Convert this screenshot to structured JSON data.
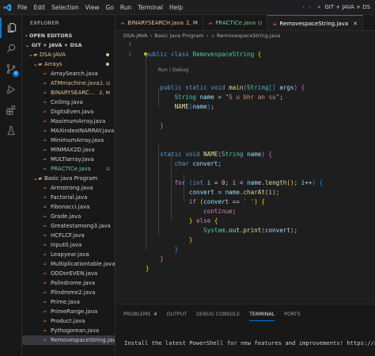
{
  "menu": [
    "File",
    "Edit",
    "Selection",
    "View",
    "Go",
    "Run",
    "Terminal",
    "Help"
  ],
  "window_title": "GIT + JAVA + DS",
  "activity": {
    "source_control_badge": "4"
  },
  "sidebar": {
    "title": "EXPLORER",
    "open_editors": "OPEN EDITORS",
    "workspace": "GIT + JAVA + DSA",
    "tree": [
      {
        "label": "DSA-JAVA",
        "type": "folder",
        "indent": 1,
        "dot": "#e2c08d"
      },
      {
        "label": "Arrays",
        "type": "folder",
        "indent": 2,
        "dot": "#e2c08d"
      },
      {
        "label": "ArraySearch.java",
        "type": "file",
        "indent": 3
      },
      {
        "label": "ATMmachine.java",
        "type": "file",
        "indent": 3,
        "status": "2, U",
        "cls": "mod"
      },
      {
        "label": "BINARYSEARC...",
        "type": "file",
        "indent": 3,
        "status": "2, M",
        "cls": "mod"
      },
      {
        "label": "Ceiling.java",
        "type": "file",
        "indent": 3
      },
      {
        "label": "DigitsEven.java",
        "type": "file",
        "indent": 3
      },
      {
        "label": "MaximumArray.java",
        "type": "file",
        "indent": 3
      },
      {
        "label": "MAXindexINARRAY.java",
        "type": "file",
        "indent": 3
      },
      {
        "label": "MinimumArray.java",
        "type": "file",
        "indent": 3
      },
      {
        "label": "MINMAX2D.java",
        "type": "file",
        "indent": 3
      },
      {
        "label": "MULTIarray.java",
        "type": "file",
        "indent": 3
      },
      {
        "label": "PRACTICe.java",
        "type": "file",
        "indent": 3,
        "status": "U",
        "cls": "untr"
      },
      {
        "label": "Basic java Program",
        "type": "folder",
        "indent": 2
      },
      {
        "label": "Armstrong.java",
        "type": "file",
        "indent": 3
      },
      {
        "label": "Factorial.java",
        "type": "file",
        "indent": 3
      },
      {
        "label": "Fibonacci.java",
        "type": "file",
        "indent": 3
      },
      {
        "label": "Grade.java",
        "type": "file",
        "indent": 3
      },
      {
        "label": "Greatestamong3.java",
        "type": "file",
        "indent": 3
      },
      {
        "label": "HCFLCF.java",
        "type": "file",
        "indent": 3
      },
      {
        "label": "Input0.java",
        "type": "file",
        "indent": 3
      },
      {
        "label": "Leapyear.java",
        "type": "file",
        "indent": 3
      },
      {
        "label": "Multiplicationtable.java",
        "type": "file",
        "indent": 3
      },
      {
        "label": "ODDorEVEN.java",
        "type": "file",
        "indent": 3
      },
      {
        "label": "Palindrome.java",
        "type": "file",
        "indent": 3
      },
      {
        "label": "Plindrome2.java",
        "type": "file",
        "indent": 3
      },
      {
        "label": "Prime.java",
        "type": "file",
        "indent": 3
      },
      {
        "label": "PrimeRange.java",
        "type": "file",
        "indent": 3
      },
      {
        "label": "Product.java",
        "type": "file",
        "indent": 3
      },
      {
        "label": "Pythogorean.java",
        "type": "file",
        "indent": 3
      },
      {
        "label": "RemovespaceString.java",
        "type": "file",
        "indent": 3,
        "selected": true
      }
    ]
  },
  "tabs": [
    {
      "label": "BINARYSEARCH.java",
      "status": "2, M",
      "cls": "mod",
      "active": false
    },
    {
      "label": "PRACTICe.java",
      "status": "U",
      "cls": "untr",
      "active": false
    },
    {
      "label": "RemovespaceString.java",
      "status": "",
      "cls": "",
      "active": true
    }
  ],
  "breadcrumb": [
    "DSA-JAVA",
    "Basic java Program",
    "RemovespaceString.java"
  ],
  "editor": {
    "line_numbers": [
      "1",
      "2"
    ],
    "codelens": "Run | Debug",
    "lines": [
      [
        [
          "kw",
          "public "
        ],
        [
          "kw",
          "class "
        ],
        [
          "ty",
          "RemovespaceString "
        ],
        [
          "br1",
          "{"
        ]
      ],
      [],
      [],
      [
        [
          "txt",
          "    "
        ],
        [
          "kw",
          "public static void "
        ],
        [
          "fn",
          "main"
        ],
        [
          "br2",
          "("
        ],
        [
          "ty",
          "String"
        ],
        [
          "br3",
          "[]"
        ],
        [
          "var",
          " args"
        ],
        [
          "br2",
          ")"
        ],
        [
          "br2",
          " {"
        ]
      ],
      [
        [
          "txt",
          "        "
        ],
        [
          "ty",
          "String "
        ],
        [
          "var",
          "name"
        ],
        [
          "txt",
          " = "
        ],
        [
          "str",
          "\"S u bhr an su\""
        ],
        [
          "txt",
          ";"
        ]
      ],
      [
        [
          "txt",
          "        "
        ],
        [
          "fn",
          "NAME"
        ],
        [
          "br3",
          "("
        ],
        [
          "var",
          "name"
        ],
        [
          "br3",
          ")"
        ],
        [
          "txt",
          ";"
        ]
      ],
      [],
      [
        [
          "txt",
          "    "
        ],
        [
          "br2",
          "}"
        ]
      ],
      [],
      [],
      [
        [
          "txt",
          "    "
        ],
        [
          "kw",
          "static void "
        ],
        [
          "fn",
          "NAME"
        ],
        [
          "br2",
          "("
        ],
        [
          "ty",
          "String "
        ],
        [
          "var",
          "name"
        ],
        [
          "br2",
          ")"
        ],
        [
          "br2",
          " {"
        ]
      ],
      [
        [
          "txt",
          "        "
        ],
        [
          "kw",
          "char "
        ],
        [
          "var",
          "convert"
        ],
        [
          "txt",
          ";"
        ]
      ],
      [],
      [
        [
          "txt",
          "        "
        ],
        [
          "kw2",
          "for "
        ],
        [
          "br3",
          "("
        ],
        [
          "kw",
          "int "
        ],
        [
          "var",
          "i"
        ],
        [
          "txt",
          " = "
        ],
        [
          "num",
          "0"
        ],
        [
          "txt",
          "; "
        ],
        [
          "var",
          "i"
        ],
        [
          "txt",
          " < "
        ],
        [
          "var",
          "name"
        ],
        [
          "txt",
          "."
        ],
        [
          "fn",
          "length"
        ],
        [
          "br1",
          "()"
        ],
        [
          "txt",
          "; "
        ],
        [
          "var",
          "i"
        ],
        [
          "txt",
          "++"
        ],
        [
          "br3",
          ")"
        ],
        [
          "br3",
          " {"
        ]
      ],
      [
        [
          "txt",
          "            "
        ],
        [
          "var",
          "convert"
        ],
        [
          "txt",
          " = "
        ],
        [
          "var",
          "name"
        ],
        [
          "txt",
          "."
        ],
        [
          "fn",
          "charAt"
        ],
        [
          "br1",
          "("
        ],
        [
          "var",
          "i"
        ],
        [
          "br1",
          ")"
        ],
        [
          "txt",
          ";"
        ]
      ],
      [
        [
          "txt",
          "            "
        ],
        [
          "kw2",
          "if "
        ],
        [
          "br1",
          "("
        ],
        [
          "var",
          "convert"
        ],
        [
          "txt",
          " == "
        ],
        [
          "str",
          "' '"
        ],
        [
          "br1",
          ")"
        ],
        [
          "br1",
          " {"
        ]
      ],
      [
        [
          "txt",
          "                "
        ],
        [
          "kw2",
          "continue"
        ],
        [
          "txt",
          ";"
        ]
      ],
      [
        [
          "txt",
          "            "
        ],
        [
          "br1",
          "}"
        ],
        [
          "kw2",
          " else "
        ],
        [
          "br1",
          "{"
        ]
      ],
      [
        [
          "txt",
          "                "
        ],
        [
          "ty",
          "System"
        ],
        [
          "txt",
          "."
        ],
        [
          "var",
          "out"
        ],
        [
          "txt",
          "."
        ],
        [
          "fn",
          "print"
        ],
        [
          "br2",
          "("
        ],
        [
          "var",
          "convert"
        ],
        [
          "br2",
          ")"
        ],
        [
          "txt",
          ";"
        ]
      ],
      [
        [
          "txt",
          "            "
        ],
        [
          "br1",
          "}"
        ]
      ],
      [
        [
          "txt",
          "        "
        ],
        [
          "br3",
          "}"
        ]
      ],
      [
        [
          "txt",
          "    "
        ],
        [
          "br2",
          "}"
        ]
      ],
      [
        [
          "br1",
          "}"
        ]
      ]
    ]
  },
  "panel": {
    "tabs": [
      {
        "label": "PROBLEMS",
        "count": "4"
      },
      {
        "label": "OUTPUT",
        "count": ""
      },
      {
        "label": "DEBUG CONSOLE",
        "count": ""
      },
      {
        "label": "TERMINAL",
        "count": "",
        "active": true
      },
      {
        "label": "PORTS",
        "count": ""
      }
    ],
    "terminal_text": "Install the latest PowerShell for new features and improvements! https://aka.ms"
  },
  "colors": {
    "accent": "#0078d4",
    "modified": "#e2c08d",
    "untracked": "#73c991"
  }
}
